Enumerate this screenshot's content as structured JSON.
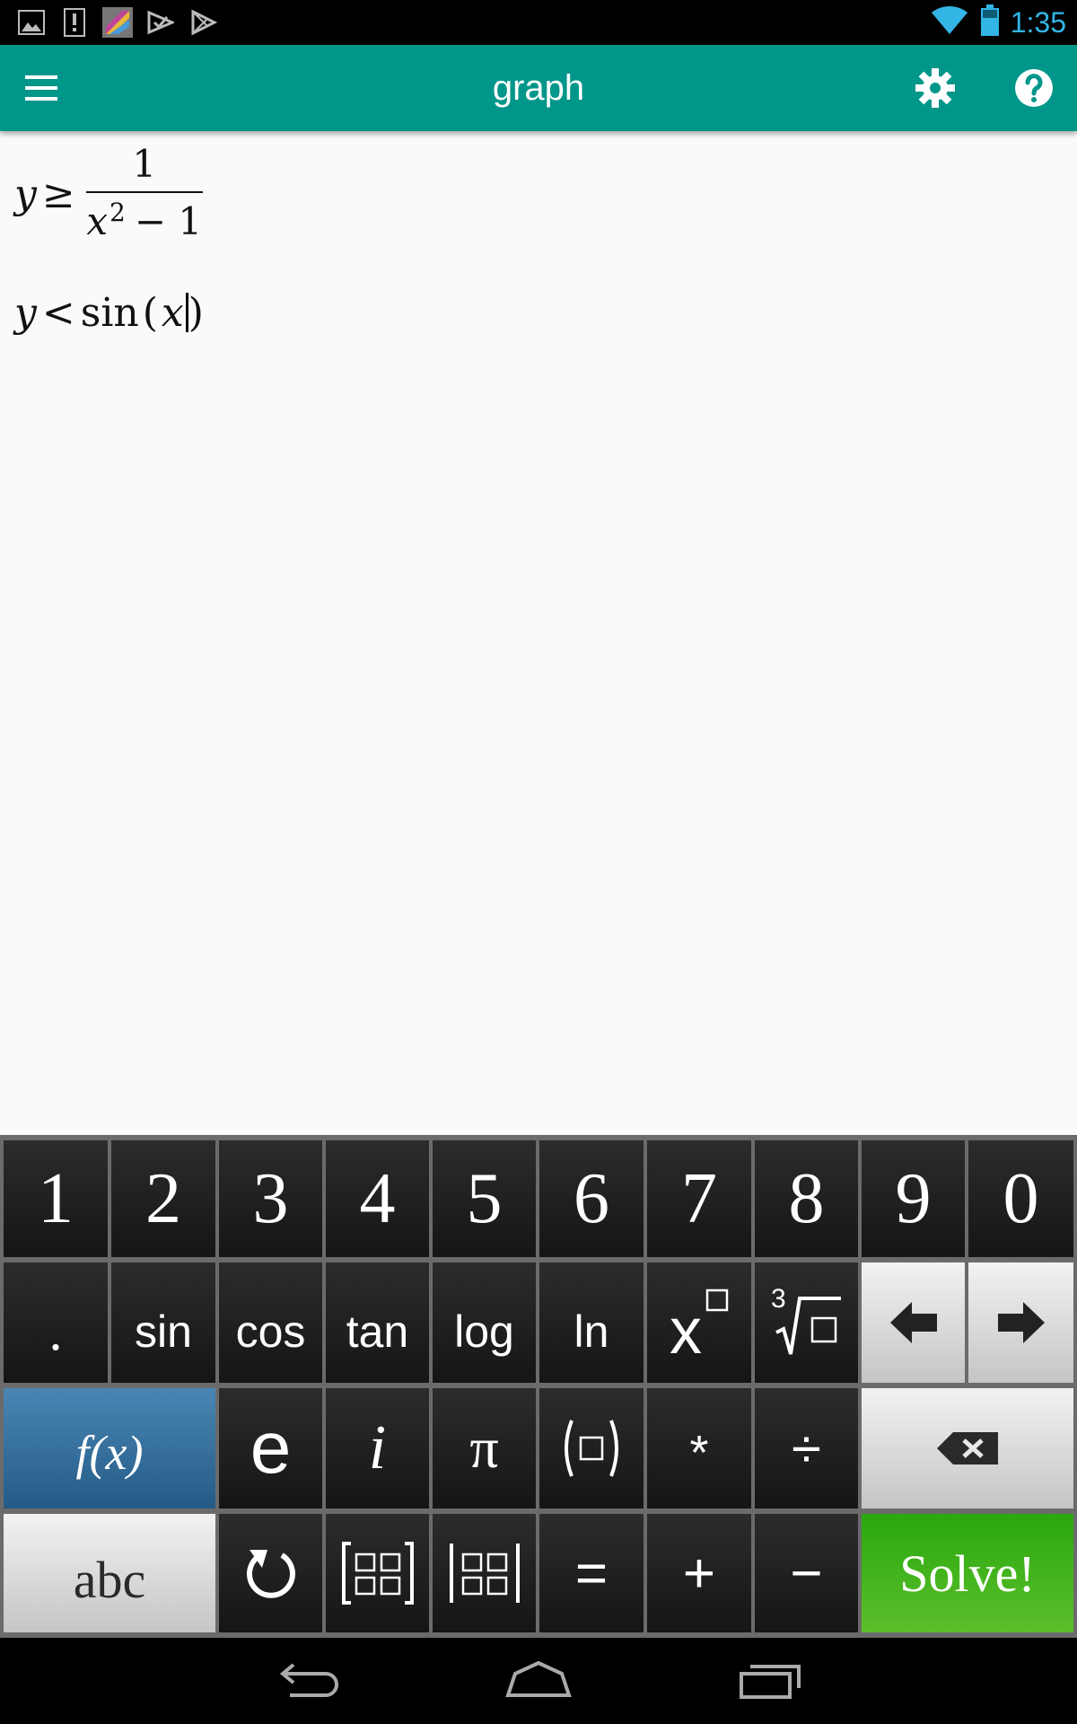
{
  "status_bar": {
    "time": "1:35",
    "icons": [
      "gallery-icon",
      "alert-icon",
      "app-icon",
      "play-games-icon",
      "play-store-icon",
      "wifi-icon",
      "battery-icon"
    ]
  },
  "app_bar": {
    "title": "graph",
    "accent_color": "#00968a"
  },
  "editor": {
    "expressions": [
      {
        "lhs": "y",
        "op": "≥",
        "numerator": "1",
        "den_base": "x",
        "den_exp": "2",
        "den_rest": "− 1"
      },
      {
        "lhs": "y",
        "op": "<",
        "func": "sin",
        "open": "(",
        "arg": "x",
        "close": ")"
      }
    ]
  },
  "keyboard": {
    "row1": [
      "1",
      "2",
      "3",
      "4",
      "5",
      "6",
      "7",
      "8",
      "9",
      "0"
    ],
    "row2": [
      ".",
      "sin",
      "cos",
      "tan",
      "log",
      "ln",
      "x",
      "3"
    ],
    "fx_label": "f(x)",
    "abc_label": "abc",
    "row3": [
      "e",
      "i",
      "π",
      "*",
      "÷"
    ],
    "row4": [
      "=",
      "+",
      "−"
    ],
    "solve_label": "Solve!",
    "solve_color": "#2aa80f",
    "fx_color": "#3a73a0"
  },
  "nav_bar": {
    "icons": [
      "back-icon",
      "home-icon",
      "recents-icon"
    ]
  }
}
